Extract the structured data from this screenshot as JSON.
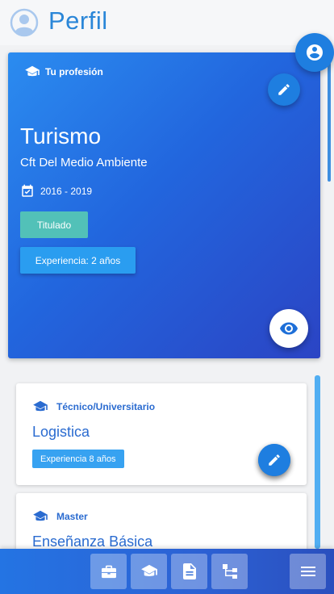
{
  "header": {
    "title": "Perfil"
  },
  "hero": {
    "section_label": "Tu profesión",
    "career": "Turismo",
    "institution": "Cft Del Medio Ambiente",
    "period": "2016 - 2019",
    "status": "Titulado",
    "experience": "Experiencia: 2 años"
  },
  "studies": [
    {
      "level": "Técnico/Universitario",
      "career": "Logistica",
      "experience": "Experiencia 8 años"
    },
    {
      "level": "Master",
      "career": "Enseñanza Básica"
    }
  ],
  "bottom_nav": {
    "items": [
      "briefcase-icon",
      "graduation-cap-icon",
      "document-icon",
      "sitemap-icon",
      "menu-icon"
    ]
  },
  "colors": {
    "primary": "#1e7ee0",
    "title_blue": "#2a86d8",
    "card_text": "#2a6bd0",
    "status_green": "#52c1b8",
    "chip_blue": "#37a2f1"
  }
}
